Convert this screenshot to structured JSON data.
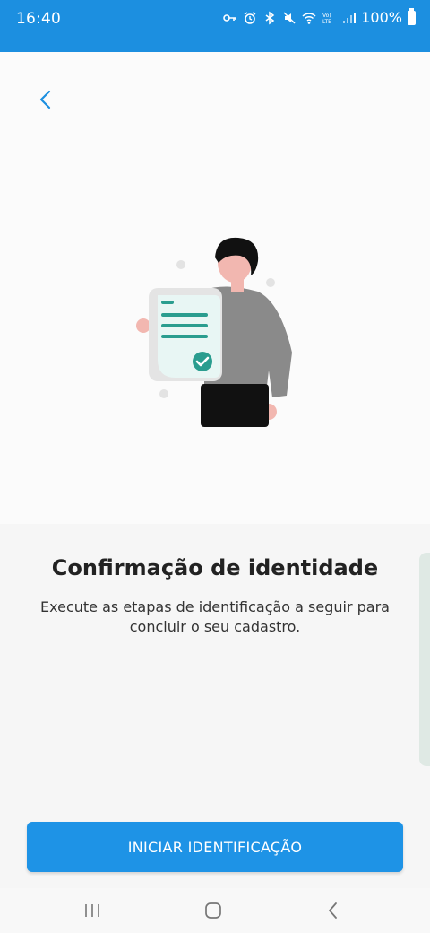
{
  "status_bar": {
    "time": "16:40",
    "battery": "100%",
    "icons": [
      "key-icon",
      "alarm-icon",
      "bluetooth-icon",
      "mute-icon",
      "wifi-icon",
      "volte-icon",
      "signal-icon",
      "battery-icon"
    ]
  },
  "header": {
    "back_icon": "chevron-left-icon"
  },
  "main": {
    "title": "Confirmação de identidade",
    "subtitle": "Execute as etapas de identificação a seguir para concluir o seu cadastro.",
    "button_label": "INICIAR IDENTIFICAÇÃO"
  },
  "colors": {
    "status_bar": "#1c8fe0",
    "primary": "#1e93e6",
    "accent_green": "#2a9d8f",
    "back_icon": "#1c8fe0"
  },
  "navbar": {
    "buttons": [
      "recent-apps-icon",
      "home-icon",
      "back-icon"
    ]
  }
}
